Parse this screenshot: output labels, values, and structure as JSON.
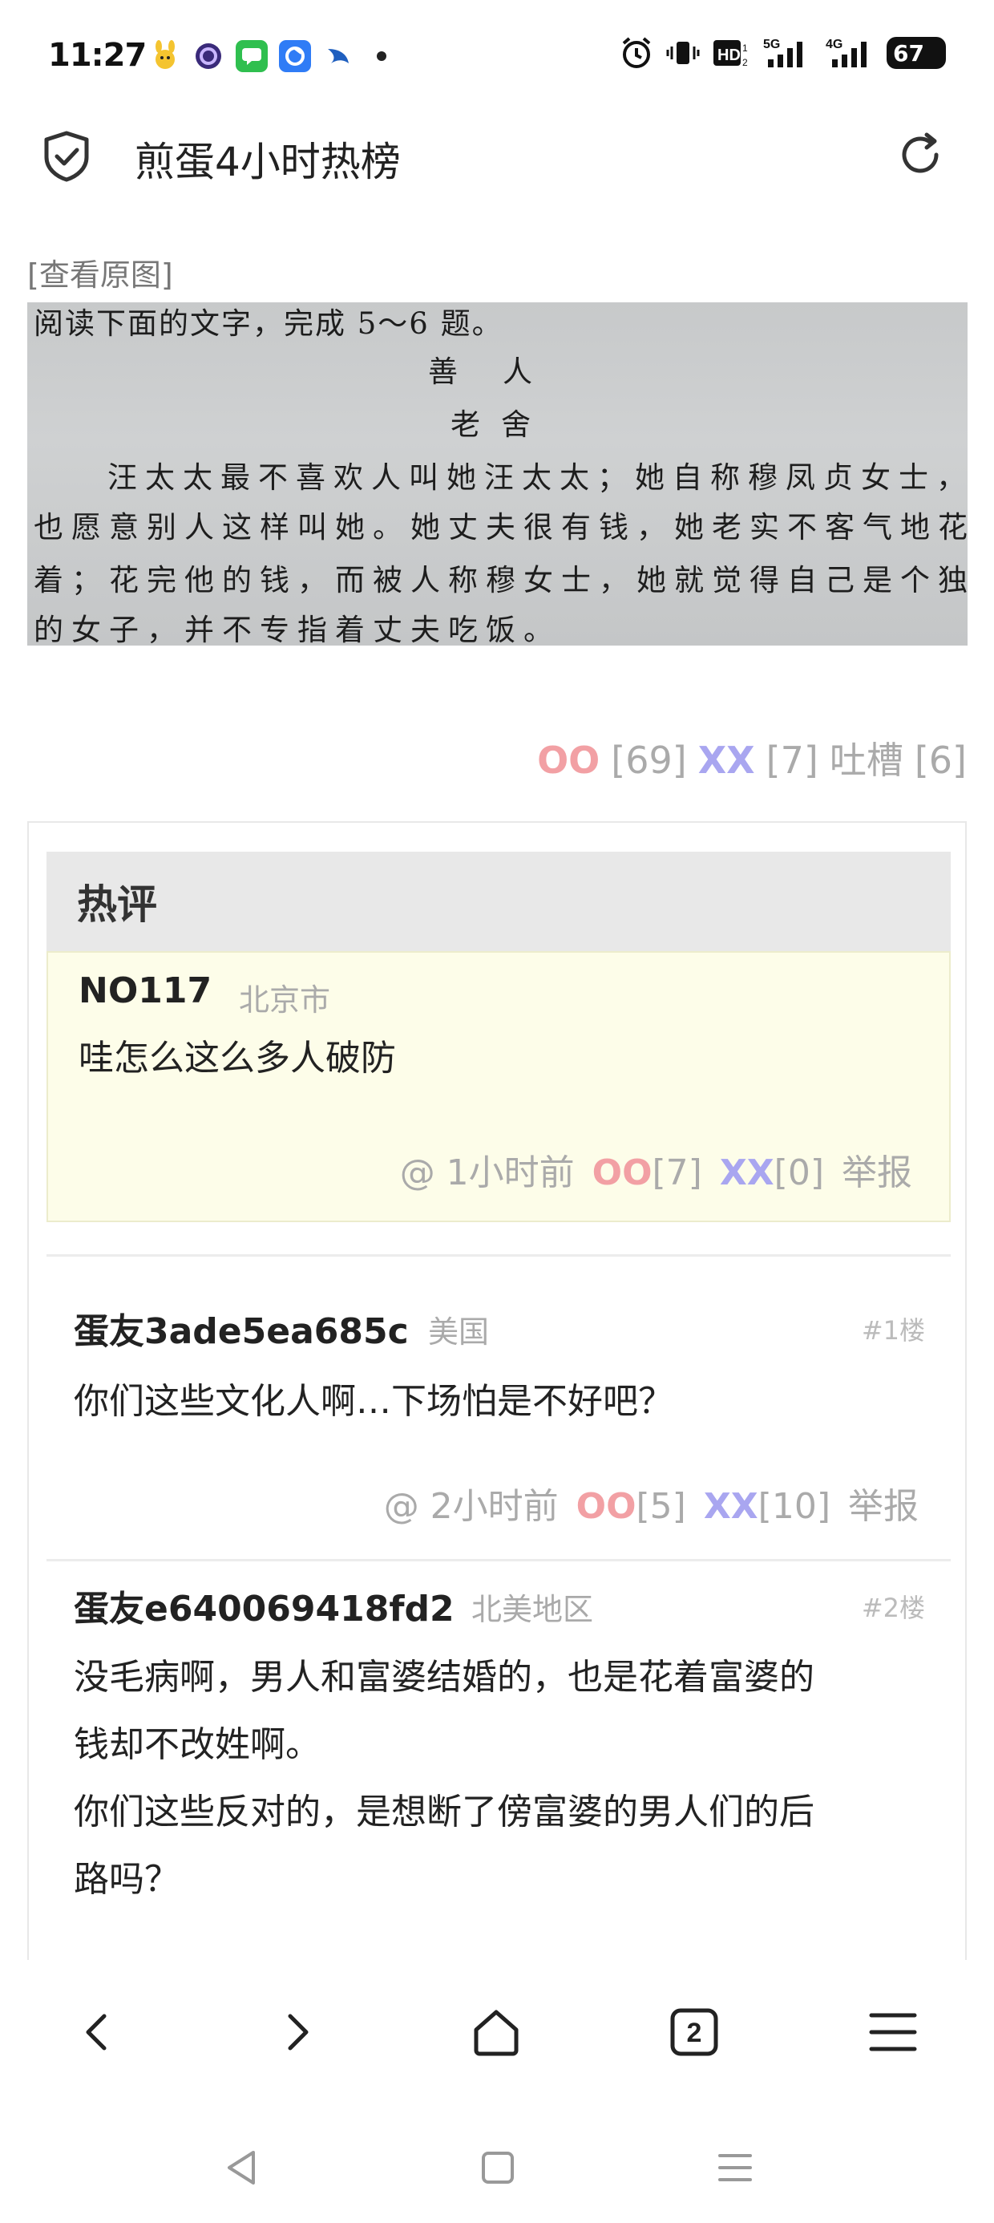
{
  "status_bar": {
    "time": "11:27",
    "app_icons": [
      "mascot-icon",
      "circle-app-icon",
      "messages-icon",
      "browser-app-icon",
      "swift-app-icon"
    ],
    "network": "5G",
    "network2": "4G",
    "battery": "67"
  },
  "header": {
    "title": "煎蛋4小时热榜"
  },
  "post": {
    "view_original": "[查看原图]",
    "image_text": {
      "line1": "阅读下面的文字，完成 5～6 题。",
      "title": "善人",
      "author": "老舍",
      "line2": "汪太太最不喜欢人叫她汪太太；她自称穆凤贞女士，",
      "line3": "也愿意别人这样叫她。她丈夫很有钱，她老实不客气地花",
      "line4": "着；花完他的钱，而被人称穆女士，她就觉得自己是个独立",
      "line5": "的女子，并不专指着丈夫吃饭。"
    },
    "votes": {
      "oo_label": "OO",
      "oo_count": "[69]",
      "xx_label": "XX",
      "xx_count": "[7]",
      "tucao_label": "吐槽",
      "tucao_count": "[6]"
    }
  },
  "hot_comments": {
    "title": "热评",
    "item": {
      "author": "NO117",
      "location": "北京市",
      "text": "哇怎么这么多人破防",
      "time": "@ 1小时前",
      "oo_label": "OO",
      "oo_count": "[7]",
      "xx_label": "XX",
      "xx_count": "[0]",
      "report": "举报"
    }
  },
  "comments": [
    {
      "author": "蛋友3ade5ea685c",
      "location": "美国",
      "floor": "#1楼",
      "text": "你们这些文化人啊…下场怕是不好吧？",
      "time": "@ 2小时前",
      "oo_label": "OO",
      "oo_count": "[5]",
      "xx_label": "XX",
      "xx_count": "[10]",
      "report": "举报"
    },
    {
      "author": "蛋友e640069418fd2",
      "location": "北美地区",
      "floor": "#2楼",
      "text_line1": "没毛病啊，男人和富婆结婚的，也是花着富婆的",
      "text_line2": "钱却不改姓啊。",
      "text_line3": "你们这些反对的，是想断了傍富婆的男人们的后",
      "text_line4": "路吗？"
    }
  ],
  "bottom_nav": {
    "tabs_count": "2"
  },
  "colors": {
    "oo": "#f2a0a4",
    "xx": "#a9a6f0",
    "hot_bg": "#fdfde9",
    "header_bg": "#e8e8e8"
  }
}
